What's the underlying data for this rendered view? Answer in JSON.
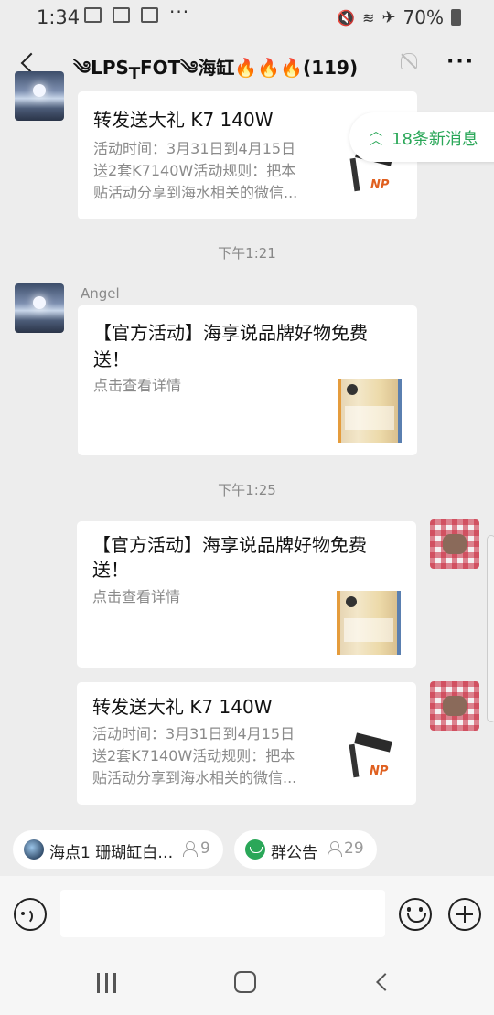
{
  "status_bar": {
    "time": "1:34",
    "battery": "70%"
  },
  "header": {
    "title": "༄LPS┰FOT༄海缸🔥🔥🔥(119)"
  },
  "new_messages": {
    "label": "18条新消息"
  },
  "messages": [
    {
      "side": "left",
      "title": "转发送大礼 K7 140W",
      "desc_lines": [
        "活动时间：3月31日到4月15日",
        "送2套K7140W活动规则：把本",
        "贴活动分享到海水相关的微信..."
      ],
      "thumb_brand": "NP"
    },
    {
      "timestamp": "下午1:21"
    },
    {
      "side": "left",
      "sender": "Angel",
      "title_lines": [
        "【官方活动】海享说品牌好物免费",
        "送！"
      ],
      "desc_lines": [
        "点击查看详情"
      ]
    },
    {
      "timestamp": "下午1:25"
    },
    {
      "side": "right",
      "title_lines": [
        "【官方活动】海享说品牌好物免费",
        "送！"
      ],
      "desc_lines": [
        "点击查看详情"
      ]
    },
    {
      "side": "right",
      "title": "转发送大礼 K7 140W",
      "desc_lines": [
        "活动时间：3月31日到4月15日",
        "送2套K7140W活动规则：把本",
        "贴活动分享到海水相关的微信..."
      ],
      "thumb_brand": "NP"
    }
  ],
  "tags": [
    {
      "label": "海点1 珊瑚缸白…",
      "count": "9",
      "icon": "group-avatar-icon"
    },
    {
      "label": "群公告",
      "count": "29",
      "icon": "announcement-icon"
    }
  ],
  "input": {
    "value": ""
  }
}
